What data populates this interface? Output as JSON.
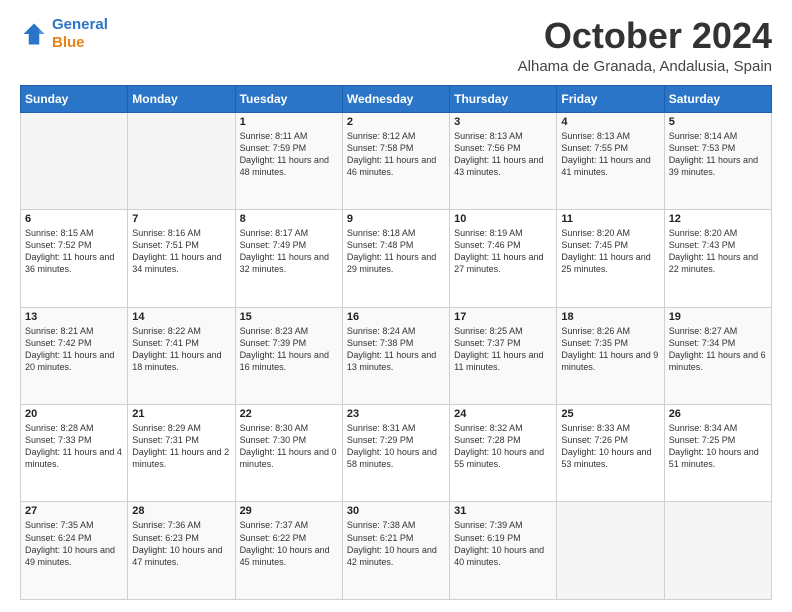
{
  "header": {
    "logo_line1": "General",
    "logo_line2": "Blue",
    "month": "October 2024",
    "location": "Alhama de Granada, Andalusia, Spain"
  },
  "days_of_week": [
    "Sunday",
    "Monday",
    "Tuesday",
    "Wednesday",
    "Thursday",
    "Friday",
    "Saturday"
  ],
  "weeks": [
    [
      {
        "day": "",
        "content": ""
      },
      {
        "day": "",
        "content": ""
      },
      {
        "day": "1",
        "content": "Sunrise: 8:11 AM\nSunset: 7:59 PM\nDaylight: 11 hours and 48 minutes."
      },
      {
        "day": "2",
        "content": "Sunrise: 8:12 AM\nSunset: 7:58 PM\nDaylight: 11 hours and 46 minutes."
      },
      {
        "day": "3",
        "content": "Sunrise: 8:13 AM\nSunset: 7:56 PM\nDaylight: 11 hours and 43 minutes."
      },
      {
        "day": "4",
        "content": "Sunrise: 8:13 AM\nSunset: 7:55 PM\nDaylight: 11 hours and 41 minutes."
      },
      {
        "day": "5",
        "content": "Sunrise: 8:14 AM\nSunset: 7:53 PM\nDaylight: 11 hours and 39 minutes."
      }
    ],
    [
      {
        "day": "6",
        "content": "Sunrise: 8:15 AM\nSunset: 7:52 PM\nDaylight: 11 hours and 36 minutes."
      },
      {
        "day": "7",
        "content": "Sunrise: 8:16 AM\nSunset: 7:51 PM\nDaylight: 11 hours and 34 minutes."
      },
      {
        "day": "8",
        "content": "Sunrise: 8:17 AM\nSunset: 7:49 PM\nDaylight: 11 hours and 32 minutes."
      },
      {
        "day": "9",
        "content": "Sunrise: 8:18 AM\nSunset: 7:48 PM\nDaylight: 11 hours and 29 minutes."
      },
      {
        "day": "10",
        "content": "Sunrise: 8:19 AM\nSunset: 7:46 PM\nDaylight: 11 hours and 27 minutes."
      },
      {
        "day": "11",
        "content": "Sunrise: 8:20 AM\nSunset: 7:45 PM\nDaylight: 11 hours and 25 minutes."
      },
      {
        "day": "12",
        "content": "Sunrise: 8:20 AM\nSunset: 7:43 PM\nDaylight: 11 hours and 22 minutes."
      }
    ],
    [
      {
        "day": "13",
        "content": "Sunrise: 8:21 AM\nSunset: 7:42 PM\nDaylight: 11 hours and 20 minutes."
      },
      {
        "day": "14",
        "content": "Sunrise: 8:22 AM\nSunset: 7:41 PM\nDaylight: 11 hours and 18 minutes."
      },
      {
        "day": "15",
        "content": "Sunrise: 8:23 AM\nSunset: 7:39 PM\nDaylight: 11 hours and 16 minutes."
      },
      {
        "day": "16",
        "content": "Sunrise: 8:24 AM\nSunset: 7:38 PM\nDaylight: 11 hours and 13 minutes."
      },
      {
        "day": "17",
        "content": "Sunrise: 8:25 AM\nSunset: 7:37 PM\nDaylight: 11 hours and 11 minutes."
      },
      {
        "day": "18",
        "content": "Sunrise: 8:26 AM\nSunset: 7:35 PM\nDaylight: 11 hours and 9 minutes."
      },
      {
        "day": "19",
        "content": "Sunrise: 8:27 AM\nSunset: 7:34 PM\nDaylight: 11 hours and 6 minutes."
      }
    ],
    [
      {
        "day": "20",
        "content": "Sunrise: 8:28 AM\nSunset: 7:33 PM\nDaylight: 11 hours and 4 minutes."
      },
      {
        "day": "21",
        "content": "Sunrise: 8:29 AM\nSunset: 7:31 PM\nDaylight: 11 hours and 2 minutes."
      },
      {
        "day": "22",
        "content": "Sunrise: 8:30 AM\nSunset: 7:30 PM\nDaylight: 11 hours and 0 minutes."
      },
      {
        "day": "23",
        "content": "Sunrise: 8:31 AM\nSunset: 7:29 PM\nDaylight: 10 hours and 58 minutes."
      },
      {
        "day": "24",
        "content": "Sunrise: 8:32 AM\nSunset: 7:28 PM\nDaylight: 10 hours and 55 minutes."
      },
      {
        "day": "25",
        "content": "Sunrise: 8:33 AM\nSunset: 7:26 PM\nDaylight: 10 hours and 53 minutes."
      },
      {
        "day": "26",
        "content": "Sunrise: 8:34 AM\nSunset: 7:25 PM\nDaylight: 10 hours and 51 minutes."
      }
    ],
    [
      {
        "day": "27",
        "content": "Sunrise: 7:35 AM\nSunset: 6:24 PM\nDaylight: 10 hours and 49 minutes."
      },
      {
        "day": "28",
        "content": "Sunrise: 7:36 AM\nSunset: 6:23 PM\nDaylight: 10 hours and 47 minutes."
      },
      {
        "day": "29",
        "content": "Sunrise: 7:37 AM\nSunset: 6:22 PM\nDaylight: 10 hours and 45 minutes."
      },
      {
        "day": "30",
        "content": "Sunrise: 7:38 AM\nSunset: 6:21 PM\nDaylight: 10 hours and 42 minutes."
      },
      {
        "day": "31",
        "content": "Sunrise: 7:39 AM\nSunset: 6:19 PM\nDaylight: 10 hours and 40 minutes."
      },
      {
        "day": "",
        "content": ""
      },
      {
        "day": "",
        "content": ""
      }
    ]
  ]
}
